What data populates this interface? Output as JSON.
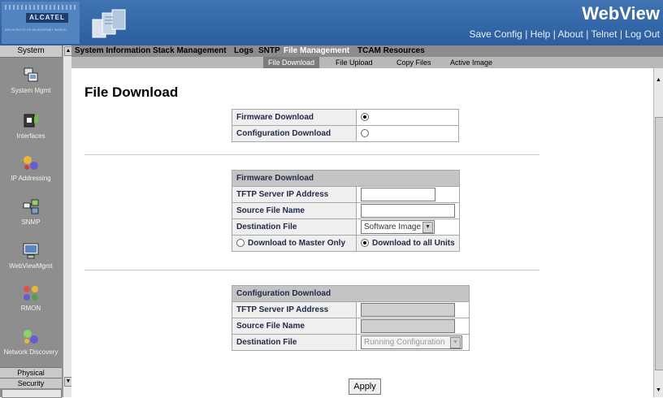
{
  "header": {
    "logo": "ALCATEL",
    "tagline": "ARCHITECTS OF AN INTERNET WORLD",
    "title": "WebView",
    "links": [
      "Save Config",
      "Help",
      "About",
      "Telnet",
      "Log Out"
    ],
    "separator": "|"
  },
  "sidebar": {
    "header": "System",
    "items": [
      {
        "label": "System Mgmt",
        "icon": "system-mgmt-icon"
      },
      {
        "label": "Interfaces",
        "icon": "interfaces-icon"
      },
      {
        "label": "IP Addressing",
        "icon": "ip-addressing-icon"
      },
      {
        "label": "SNMP",
        "icon": "snmp-icon"
      },
      {
        "label": "WebViewMgmt",
        "icon": "webview-mgmt-icon"
      },
      {
        "label": "RMON",
        "icon": "rmon-icon"
      },
      {
        "label": "Network Discovery",
        "icon": "network-discovery-icon"
      }
    ],
    "tabs": [
      "Physical",
      "Security"
    ]
  },
  "menu": {
    "items": [
      "System Information",
      "Stack Management",
      "Logs",
      "SNTP",
      "File Management",
      "TCAM Resources"
    ],
    "active": "File Management"
  },
  "submenu": {
    "items": [
      "File Download",
      "File Upload",
      "Copy Files",
      "Active Image"
    ],
    "active": "File Download"
  },
  "page": {
    "title": "File Download",
    "type_selector": [
      {
        "label": "Firmware Download",
        "selected": true
      },
      {
        "label": "Configuration Download",
        "selected": false
      }
    ],
    "firmware": {
      "header": "Firmware Download",
      "tftp_label": "TFTP Server IP Address",
      "tftp_value": "",
      "source_label": "Source File Name",
      "source_value": "",
      "dest_label": "Destination File",
      "dest_value": "Software Image",
      "opt_master": "Download to Master Only",
      "opt_all": "Download to all Units",
      "selected_option": "Download to all Units"
    },
    "configuration": {
      "header": "Configuration Download",
      "tftp_label": "TFTP Server IP Address",
      "source_label": "Source File Name",
      "dest_label": "Destination File",
      "dest_value": "Running Configuration"
    },
    "apply_label": "Apply"
  }
}
